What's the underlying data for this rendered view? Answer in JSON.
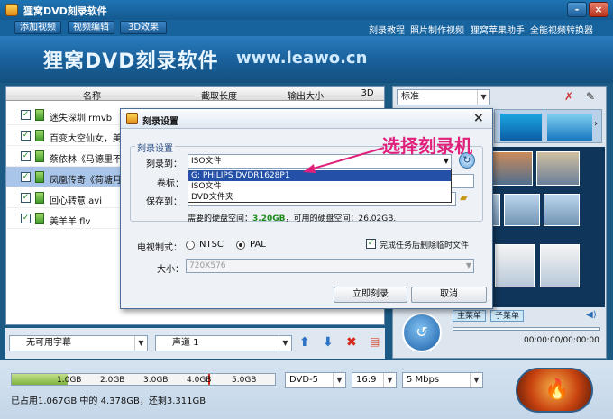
{
  "app": {
    "title": "狸窝DVD刻录软件",
    "window_buttons": [
      "-",
      "×"
    ]
  },
  "toolbar": {
    "tabs": [
      "添加视频",
      "视频编辑",
      "3D效果"
    ],
    "links": [
      "刻录教程",
      "照片制作视频",
      "狸窝苹果助手",
      "全能视频转换器"
    ]
  },
  "banner": {
    "brand": "狸窝DVD刻录软件",
    "url": "www.leawo.cn"
  },
  "file_table": {
    "columns": [
      "名称",
      "截取长度",
      "输出大小",
      "3D"
    ],
    "rows": [
      {
        "name": "迷失深圳.rmvb",
        "checked": "✓"
      },
      {
        "name": "百变大空仙女，美",
        "checked": "✓"
      },
      {
        "name": "蔡依林《马德里不",
        "checked": "✓"
      },
      {
        "name": "凤凰传奇《荷塘月",
        "checked": "✓",
        "selected": true
      },
      {
        "name": "回心转意.avi",
        "checked": "✓"
      },
      {
        "name": "美羊羊.flv",
        "checked": "✓"
      }
    ]
  },
  "left_controls": {
    "subtitle": "无可用字幕",
    "audio": "声道 1"
  },
  "right_panel": {
    "template_select": "标准",
    "tab_main": "主菜单",
    "tab_sub": "子菜单",
    "time": "00:00:00/00:00:00"
  },
  "bottom": {
    "ticks": [
      "1.0GB",
      "2.0GB",
      "3.0GB",
      "4.0GB",
      "5.0GB"
    ],
    "used_fraction": 0.2135,
    "disc": "DVD-5",
    "aspect": "16:9",
    "bitrate": "5 Mbps",
    "status": "已占用1.067GB 中的 4.378GB，还剩3.311GB"
  },
  "dialog": {
    "title": "刻录设置",
    "group": "刻录设置",
    "burn_to_label": "刻录到：",
    "burn_to_value": "ISO文件",
    "volume_label": "卷标：",
    "save_to_label": "保存到：",
    "space_prefix": "需要的硬盘空间：",
    "space_required": "3.20GB",
    "space_available": "，可用的硬盘空间：26.02GB.",
    "tv_label": "电视制式：",
    "ntsc": "NTSC",
    "pal": "PAL",
    "delete_temp": "完成任务后删除临时文件",
    "size_label": "大小：",
    "size_value": "720X576",
    "ok": "立即刻录",
    "cancel": "取消",
    "options": [
      "G: PHILIPS  DVDR1628P1",
      "ISO文件",
      "DVD文件夹"
    ]
  },
  "annotation": "选择刻录机"
}
